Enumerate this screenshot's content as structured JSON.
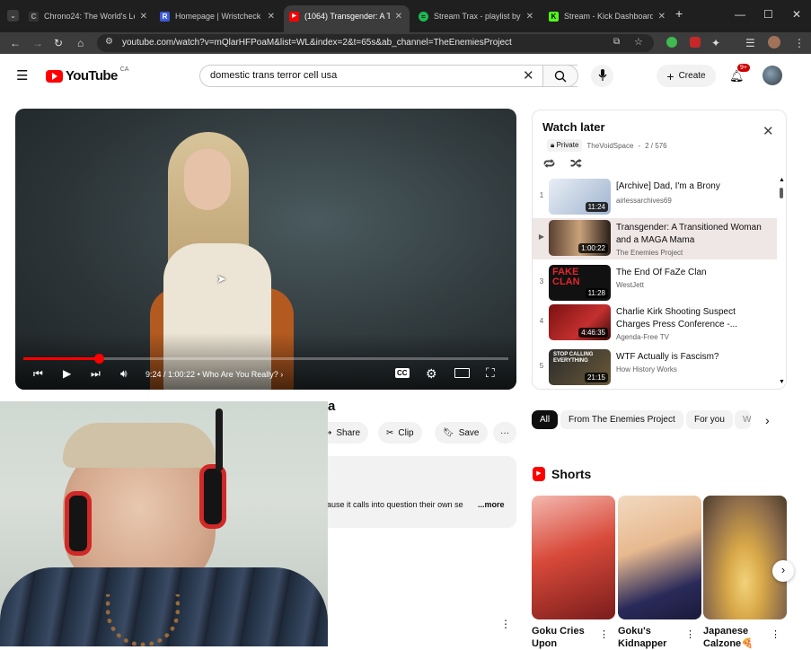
{
  "browser": {
    "tabs": [
      {
        "title": "Chrono24: The World's Le",
        "icon": "chrono24-icon"
      },
      {
        "title": "Homepage | Wristcheck",
        "icon": "wristcheck-icon"
      },
      {
        "title": "(1064) Transgender: A Tr",
        "icon": "youtube-icon"
      },
      {
        "title": "Stream Trax - playlist by",
        "icon": "spotify-icon"
      },
      {
        "title": "Stream - Kick Dashboard",
        "icon": "kick-icon"
      }
    ],
    "url": "youtube.com/watch?v=mQlarHFPoaM&list=WL&index=2&t=65s&ab_channel=TheEnemiesProject"
  },
  "youtube": {
    "logo_text": "YouTube",
    "region": "CA",
    "search_value": "domestic trans terror cell usa",
    "create_label": "Create",
    "notification_count": "9+"
  },
  "player": {
    "time": "9:24 / 1:00:22",
    "chapter": "Who Are You Really?",
    "progress": 0.156
  },
  "video_meta": {
    "title_fragment": "a",
    "share_label": "Share",
    "clip_label": "Clip",
    "save_label": "Save",
    "description_snippet": "ause it calls into question their own se",
    "more_label": "...more"
  },
  "playlist": {
    "title": "Watch later",
    "privacy": "Private",
    "owner": "TheVoidSpace",
    "position": "2 / 576",
    "items": [
      {
        "index": "1",
        "title": "[Archive] Dad, I'm a Brony",
        "channel": "airlessarchives69",
        "duration": "11:24"
      },
      {
        "index": "▶",
        "title": "Transgender: A Transitioned Woman and a MAGA Mama",
        "channel": "The Enemies Project",
        "duration": "1:00:22"
      },
      {
        "index": "3",
        "title": "The End Of FaZe Clan",
        "channel": "WestJett",
        "duration": "11:28"
      },
      {
        "index": "4",
        "title": "Charlie Kirk Shooting Suspect Charges Press Conference -...",
        "channel": "Agenda-Free TV",
        "duration": "4:46:35"
      },
      {
        "index": "5",
        "title": "WTF Actually is Fascism?",
        "channel": "How History Works",
        "duration": "21:15"
      }
    ]
  },
  "chips": [
    "All",
    "From The Enemies Project",
    "For you",
    "W"
  ],
  "shorts": {
    "heading": "Shorts",
    "items": [
      {
        "title": "Goku Cries Upon"
      },
      {
        "title": "Goku's Kidnapper"
      },
      {
        "title": "Japanese Calzone🍕"
      }
    ]
  },
  "colors": {
    "youtube_red": "#ff0000",
    "browser_dark": "#1f1f1f",
    "chip_selected": "#0f0f0f"
  }
}
